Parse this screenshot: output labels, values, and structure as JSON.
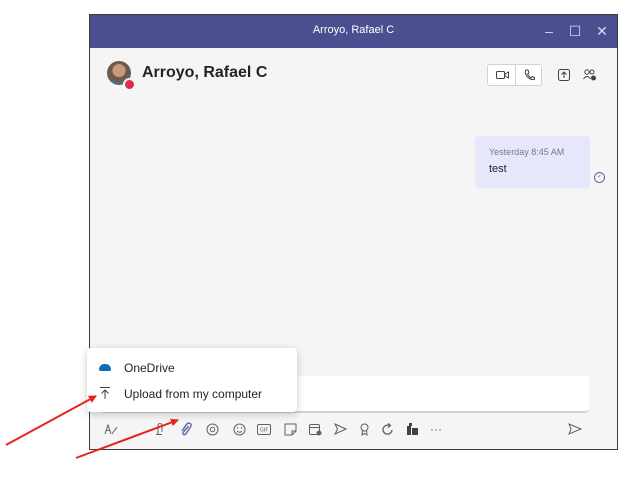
{
  "window": {
    "title": "Arroyo, Rafael C",
    "controls": [
      {
        "name": "minimize",
        "glyph": "–"
      },
      {
        "name": "maximize",
        "glyph": "☐"
      },
      {
        "name": "close",
        "glyph": "✕"
      }
    ]
  },
  "chat": {
    "contact_name": "Arroyo, Rafael C",
    "presence": "busy",
    "header_icons": [
      "video-call-icon",
      "audio-call-icon",
      "share-screen-icon",
      "add-people-icon"
    ]
  },
  "messages": [
    {
      "timestamp": "Yesterday 8:45 AM",
      "text": "test",
      "status": "seen"
    }
  ],
  "attach_menu": {
    "items": [
      {
        "label": "OneDrive",
        "icon": "onedrive-icon"
      },
      {
        "label": "Upload from my computer",
        "icon": "upload-icon"
      }
    ]
  },
  "toolbar": {
    "tools": [
      "format-icon",
      "attach-icon",
      "attach-icon (selected)",
      "loop-icon",
      "emoji-icon",
      "gif-icon",
      "sticker-icon",
      "schedule-meeting-icon",
      "stream-icon",
      "praise-icon",
      "refresh-icon",
      "apps-icon",
      "more-icon",
      "send-icon"
    ]
  },
  "colors": {
    "titlebar": "#4b4f8f",
    "bubble": "#e7e7fb",
    "accent": "#6264a7",
    "annotation_arrow": "#e8231f"
  }
}
